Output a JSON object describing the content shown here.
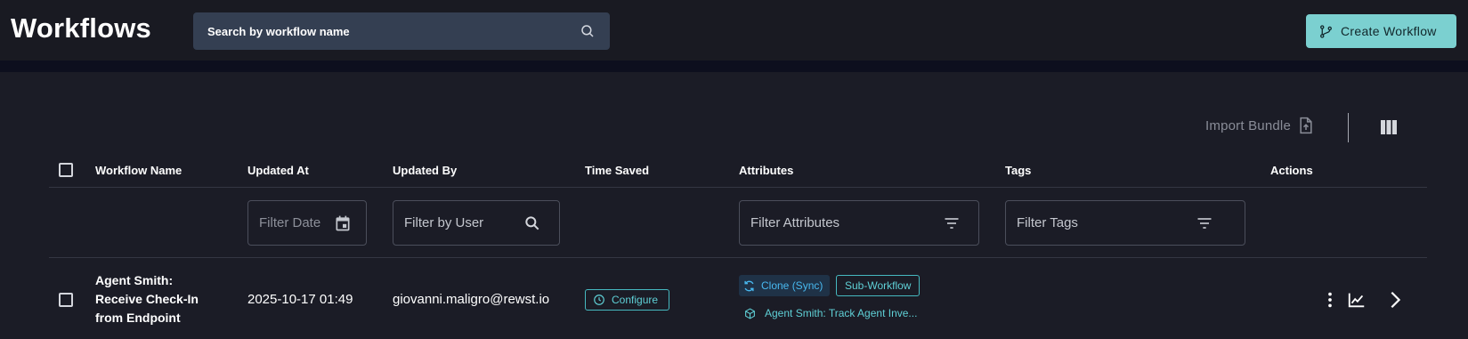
{
  "header": {
    "title": "Workflows",
    "search_placeholder": "Search by workflow name",
    "create_label": "Create Workflow"
  },
  "toolbar": {
    "import_label": "Import Bundle"
  },
  "table": {
    "columns": [
      "Workflow Name",
      "Updated At",
      "Updated By",
      "Time Saved",
      "Attributes",
      "Tags",
      "Actions"
    ],
    "filters": {
      "date_placeholder": "Filter Date",
      "user_placeholder": "Filter by User",
      "attributes_placeholder": "Filter Attributes",
      "tags_placeholder": "Filter Tags"
    },
    "rows": [
      {
        "name": "Agent Smith: Receive Check-In from Endpoint",
        "updated_at": "2025-10-17 01:49",
        "updated_by": "giovanni.maligro@rewst.io",
        "time_saved_label": "Configure",
        "attributes": [
          "Clone (Sync)",
          "Sub-Workflow",
          "Agent Smith: Track Agent Inve..."
        ]
      }
    ]
  },
  "colors": {
    "accent": "#7bd0d0",
    "teal_text": "#5fd0d6",
    "clone_blue": "#48b8ef",
    "background": "#1b1c26"
  },
  "icons": [
    "search-icon",
    "git-branch-icon",
    "file-upload-icon",
    "columns-icon",
    "calendar-icon",
    "filter-icon",
    "clock-icon",
    "sync-icon",
    "cube-icon",
    "more-vertical-icon",
    "chart-icon",
    "chevron-right-icon"
  ]
}
